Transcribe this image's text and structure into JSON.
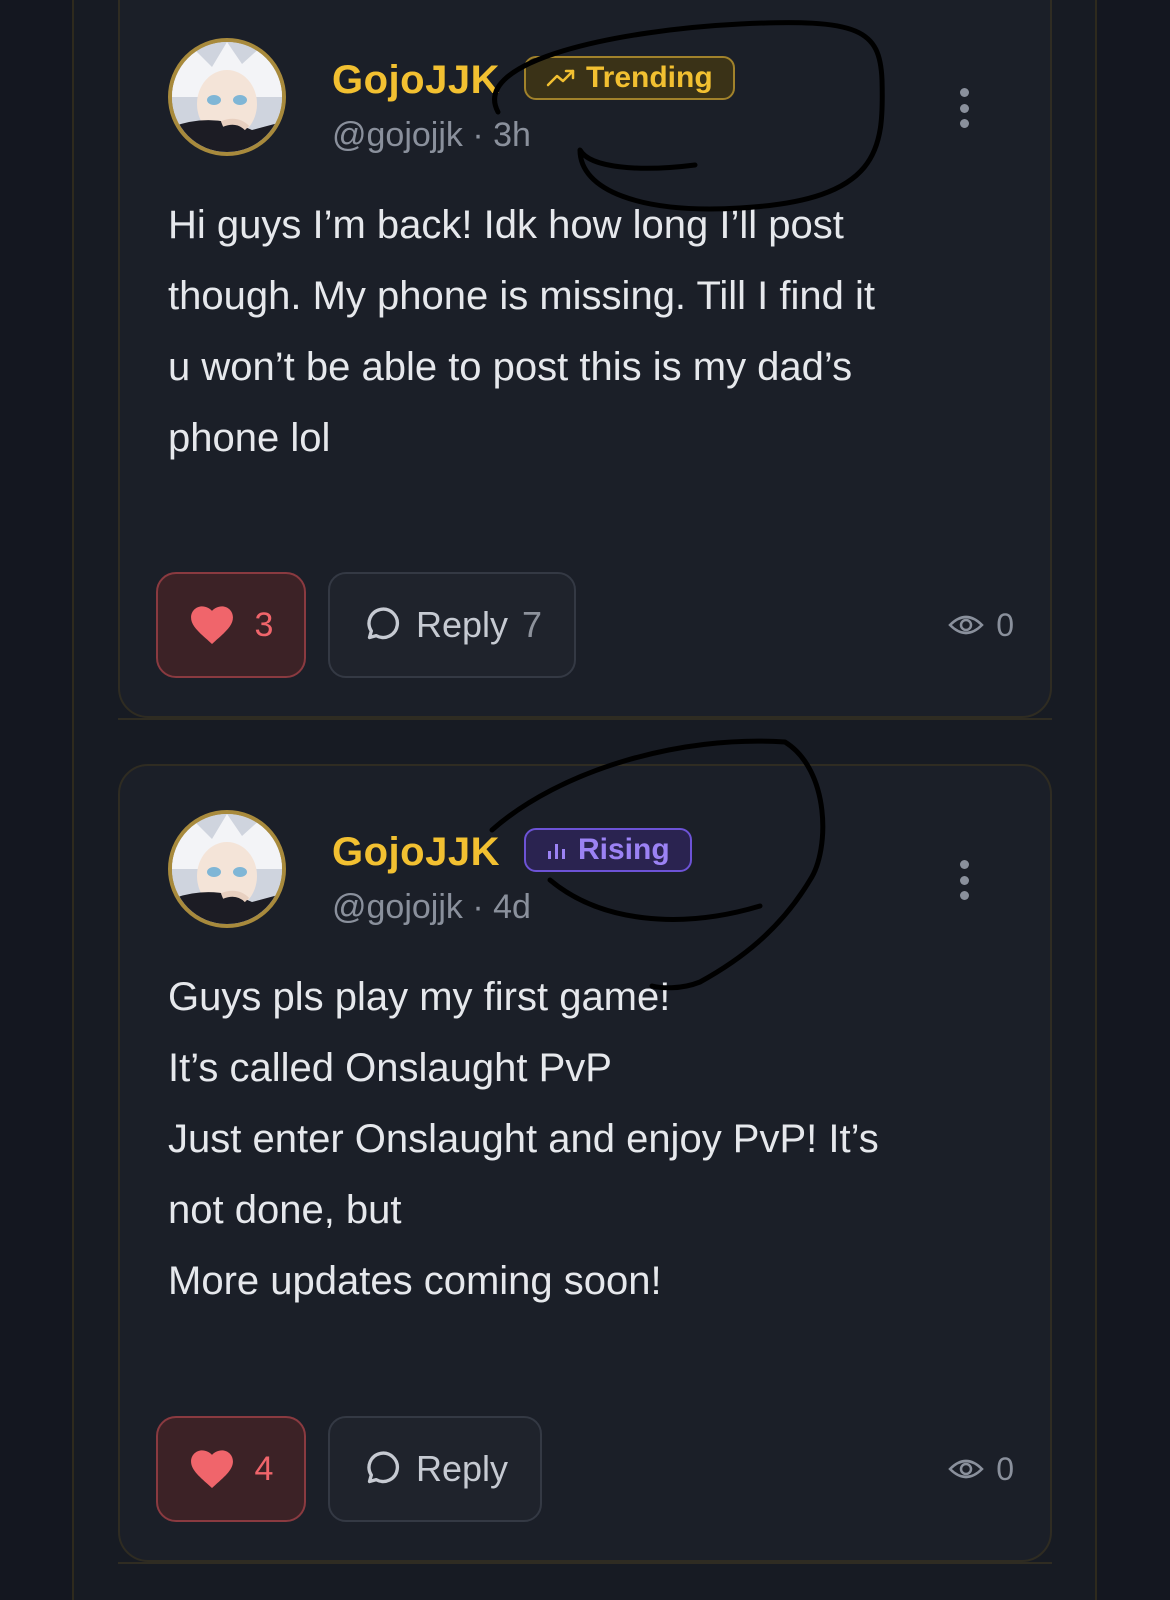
{
  "posts": [
    {
      "username": "GojoJJK",
      "badge": {
        "label": "Trending",
        "icon": "trending-up-icon",
        "color": "#f2c031"
      },
      "handle": "@gojojjk",
      "separator": "·",
      "time": "3h",
      "body": [
        "Hi guys I’m back! Idk how long I’ll post",
        "though. My phone is missing. Till I find it",
        "u won’t be able to post this is my dad’s",
        "phone lol"
      ],
      "likes": "3",
      "reply_label": "Reply",
      "reply_count": "7",
      "views": "0"
    },
    {
      "username": "GojoJJK",
      "badge": {
        "label": "Rising",
        "icon": "bar-chart-icon",
        "color": "#9b82f4"
      },
      "handle": "@gojojjk",
      "separator": "·",
      "time": "4d",
      "body": [
        "Guys pls play my first game!",
        "It’s called Onslaught PvP",
        "Just enter Onslaught and enjoy PvP! It’s",
        "not done, but",
        "More updates coming soon!"
      ],
      "likes": "4",
      "reply_label": "Reply",
      "reply_count": "",
      "views": "0"
    }
  ],
  "colors": {
    "background": "#141720",
    "card": "#1b1f28",
    "username": "#f2c031",
    "like": "#f0656b",
    "muted": "#8a909c"
  }
}
